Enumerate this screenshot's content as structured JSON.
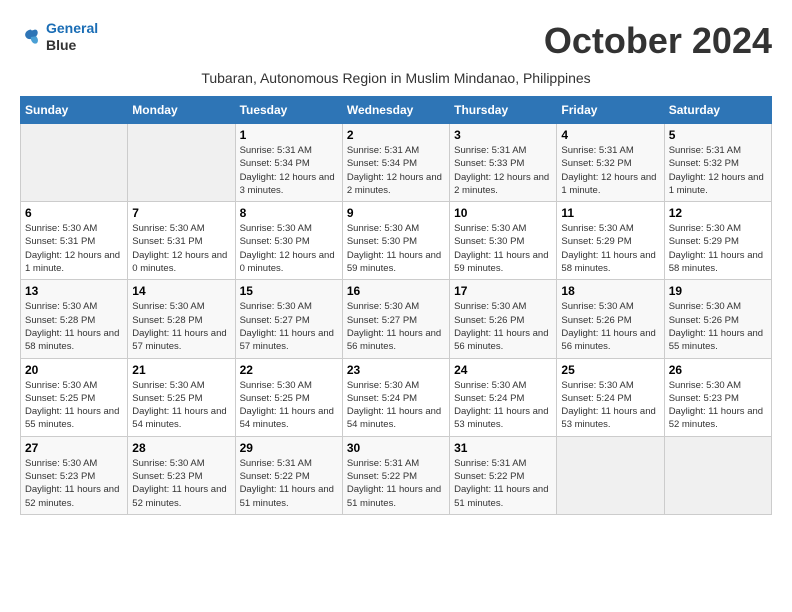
{
  "header": {
    "logo": {
      "line1": "General",
      "line2": "Blue"
    },
    "title": "October 2024",
    "subtitle": "Tubaran, Autonomous Region in Muslim Mindanao, Philippines"
  },
  "weekdays": [
    "Sunday",
    "Monday",
    "Tuesday",
    "Wednesday",
    "Thursday",
    "Friday",
    "Saturday"
  ],
  "weeks": [
    [
      {
        "day": "",
        "info": ""
      },
      {
        "day": "",
        "info": ""
      },
      {
        "day": "1",
        "info": "Sunrise: 5:31 AM\nSunset: 5:34 PM\nDaylight: 12 hours and 3 minutes."
      },
      {
        "day": "2",
        "info": "Sunrise: 5:31 AM\nSunset: 5:34 PM\nDaylight: 12 hours and 2 minutes."
      },
      {
        "day": "3",
        "info": "Sunrise: 5:31 AM\nSunset: 5:33 PM\nDaylight: 12 hours and 2 minutes."
      },
      {
        "day": "4",
        "info": "Sunrise: 5:31 AM\nSunset: 5:32 PM\nDaylight: 12 hours and 1 minute."
      },
      {
        "day": "5",
        "info": "Sunrise: 5:31 AM\nSunset: 5:32 PM\nDaylight: 12 hours and 1 minute."
      }
    ],
    [
      {
        "day": "6",
        "info": "Sunrise: 5:30 AM\nSunset: 5:31 PM\nDaylight: 12 hours and 1 minute."
      },
      {
        "day": "7",
        "info": "Sunrise: 5:30 AM\nSunset: 5:31 PM\nDaylight: 12 hours and 0 minutes."
      },
      {
        "day": "8",
        "info": "Sunrise: 5:30 AM\nSunset: 5:30 PM\nDaylight: 12 hours and 0 minutes."
      },
      {
        "day": "9",
        "info": "Sunrise: 5:30 AM\nSunset: 5:30 PM\nDaylight: 11 hours and 59 minutes."
      },
      {
        "day": "10",
        "info": "Sunrise: 5:30 AM\nSunset: 5:30 PM\nDaylight: 11 hours and 59 minutes."
      },
      {
        "day": "11",
        "info": "Sunrise: 5:30 AM\nSunset: 5:29 PM\nDaylight: 11 hours and 58 minutes."
      },
      {
        "day": "12",
        "info": "Sunrise: 5:30 AM\nSunset: 5:29 PM\nDaylight: 11 hours and 58 minutes."
      }
    ],
    [
      {
        "day": "13",
        "info": "Sunrise: 5:30 AM\nSunset: 5:28 PM\nDaylight: 11 hours and 58 minutes."
      },
      {
        "day": "14",
        "info": "Sunrise: 5:30 AM\nSunset: 5:28 PM\nDaylight: 11 hours and 57 minutes."
      },
      {
        "day": "15",
        "info": "Sunrise: 5:30 AM\nSunset: 5:27 PM\nDaylight: 11 hours and 57 minutes."
      },
      {
        "day": "16",
        "info": "Sunrise: 5:30 AM\nSunset: 5:27 PM\nDaylight: 11 hours and 56 minutes."
      },
      {
        "day": "17",
        "info": "Sunrise: 5:30 AM\nSunset: 5:26 PM\nDaylight: 11 hours and 56 minutes."
      },
      {
        "day": "18",
        "info": "Sunrise: 5:30 AM\nSunset: 5:26 PM\nDaylight: 11 hours and 56 minutes."
      },
      {
        "day": "19",
        "info": "Sunrise: 5:30 AM\nSunset: 5:26 PM\nDaylight: 11 hours and 55 minutes."
      }
    ],
    [
      {
        "day": "20",
        "info": "Sunrise: 5:30 AM\nSunset: 5:25 PM\nDaylight: 11 hours and 55 minutes."
      },
      {
        "day": "21",
        "info": "Sunrise: 5:30 AM\nSunset: 5:25 PM\nDaylight: 11 hours and 54 minutes."
      },
      {
        "day": "22",
        "info": "Sunrise: 5:30 AM\nSunset: 5:25 PM\nDaylight: 11 hours and 54 minutes."
      },
      {
        "day": "23",
        "info": "Sunrise: 5:30 AM\nSunset: 5:24 PM\nDaylight: 11 hours and 54 minutes."
      },
      {
        "day": "24",
        "info": "Sunrise: 5:30 AM\nSunset: 5:24 PM\nDaylight: 11 hours and 53 minutes."
      },
      {
        "day": "25",
        "info": "Sunrise: 5:30 AM\nSunset: 5:24 PM\nDaylight: 11 hours and 53 minutes."
      },
      {
        "day": "26",
        "info": "Sunrise: 5:30 AM\nSunset: 5:23 PM\nDaylight: 11 hours and 52 minutes."
      }
    ],
    [
      {
        "day": "27",
        "info": "Sunrise: 5:30 AM\nSunset: 5:23 PM\nDaylight: 11 hours and 52 minutes."
      },
      {
        "day": "28",
        "info": "Sunrise: 5:30 AM\nSunset: 5:23 PM\nDaylight: 11 hours and 52 minutes."
      },
      {
        "day": "29",
        "info": "Sunrise: 5:31 AM\nSunset: 5:22 PM\nDaylight: 11 hours and 51 minutes."
      },
      {
        "day": "30",
        "info": "Sunrise: 5:31 AM\nSunset: 5:22 PM\nDaylight: 11 hours and 51 minutes."
      },
      {
        "day": "31",
        "info": "Sunrise: 5:31 AM\nSunset: 5:22 PM\nDaylight: 11 hours and 51 minutes."
      },
      {
        "day": "",
        "info": ""
      },
      {
        "day": "",
        "info": ""
      }
    ]
  ]
}
